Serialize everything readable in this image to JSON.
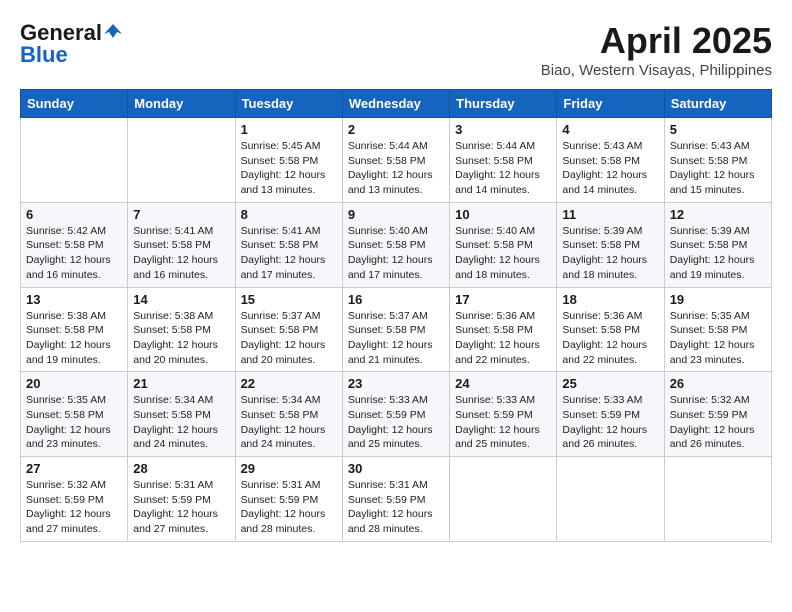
{
  "header": {
    "logo_general": "General",
    "logo_blue": "Blue",
    "month": "April 2025",
    "location": "Biao, Western Visayas, Philippines"
  },
  "weekdays": [
    "Sunday",
    "Monday",
    "Tuesday",
    "Wednesday",
    "Thursday",
    "Friday",
    "Saturday"
  ],
  "weeks": [
    [
      {
        "day": "",
        "info": ""
      },
      {
        "day": "",
        "info": ""
      },
      {
        "day": "1",
        "info": "Sunrise: 5:45 AM\nSunset: 5:58 PM\nDaylight: 12 hours\nand 13 minutes."
      },
      {
        "day": "2",
        "info": "Sunrise: 5:44 AM\nSunset: 5:58 PM\nDaylight: 12 hours\nand 13 minutes."
      },
      {
        "day": "3",
        "info": "Sunrise: 5:44 AM\nSunset: 5:58 PM\nDaylight: 12 hours\nand 14 minutes."
      },
      {
        "day": "4",
        "info": "Sunrise: 5:43 AM\nSunset: 5:58 PM\nDaylight: 12 hours\nand 14 minutes."
      },
      {
        "day": "5",
        "info": "Sunrise: 5:43 AM\nSunset: 5:58 PM\nDaylight: 12 hours\nand 15 minutes."
      }
    ],
    [
      {
        "day": "6",
        "info": "Sunrise: 5:42 AM\nSunset: 5:58 PM\nDaylight: 12 hours\nand 16 minutes."
      },
      {
        "day": "7",
        "info": "Sunrise: 5:41 AM\nSunset: 5:58 PM\nDaylight: 12 hours\nand 16 minutes."
      },
      {
        "day": "8",
        "info": "Sunrise: 5:41 AM\nSunset: 5:58 PM\nDaylight: 12 hours\nand 17 minutes."
      },
      {
        "day": "9",
        "info": "Sunrise: 5:40 AM\nSunset: 5:58 PM\nDaylight: 12 hours\nand 17 minutes."
      },
      {
        "day": "10",
        "info": "Sunrise: 5:40 AM\nSunset: 5:58 PM\nDaylight: 12 hours\nand 18 minutes."
      },
      {
        "day": "11",
        "info": "Sunrise: 5:39 AM\nSunset: 5:58 PM\nDaylight: 12 hours\nand 18 minutes."
      },
      {
        "day": "12",
        "info": "Sunrise: 5:39 AM\nSunset: 5:58 PM\nDaylight: 12 hours\nand 19 minutes."
      }
    ],
    [
      {
        "day": "13",
        "info": "Sunrise: 5:38 AM\nSunset: 5:58 PM\nDaylight: 12 hours\nand 19 minutes."
      },
      {
        "day": "14",
        "info": "Sunrise: 5:38 AM\nSunset: 5:58 PM\nDaylight: 12 hours\nand 20 minutes."
      },
      {
        "day": "15",
        "info": "Sunrise: 5:37 AM\nSunset: 5:58 PM\nDaylight: 12 hours\nand 20 minutes."
      },
      {
        "day": "16",
        "info": "Sunrise: 5:37 AM\nSunset: 5:58 PM\nDaylight: 12 hours\nand 21 minutes."
      },
      {
        "day": "17",
        "info": "Sunrise: 5:36 AM\nSunset: 5:58 PM\nDaylight: 12 hours\nand 22 minutes."
      },
      {
        "day": "18",
        "info": "Sunrise: 5:36 AM\nSunset: 5:58 PM\nDaylight: 12 hours\nand 22 minutes."
      },
      {
        "day": "19",
        "info": "Sunrise: 5:35 AM\nSunset: 5:58 PM\nDaylight: 12 hours\nand 23 minutes."
      }
    ],
    [
      {
        "day": "20",
        "info": "Sunrise: 5:35 AM\nSunset: 5:58 PM\nDaylight: 12 hours\nand 23 minutes."
      },
      {
        "day": "21",
        "info": "Sunrise: 5:34 AM\nSunset: 5:58 PM\nDaylight: 12 hours\nand 24 minutes."
      },
      {
        "day": "22",
        "info": "Sunrise: 5:34 AM\nSunset: 5:58 PM\nDaylight: 12 hours\nand 24 minutes."
      },
      {
        "day": "23",
        "info": "Sunrise: 5:33 AM\nSunset: 5:59 PM\nDaylight: 12 hours\nand 25 minutes."
      },
      {
        "day": "24",
        "info": "Sunrise: 5:33 AM\nSunset: 5:59 PM\nDaylight: 12 hours\nand 25 minutes."
      },
      {
        "day": "25",
        "info": "Sunrise: 5:33 AM\nSunset: 5:59 PM\nDaylight: 12 hours\nand 26 minutes."
      },
      {
        "day": "26",
        "info": "Sunrise: 5:32 AM\nSunset: 5:59 PM\nDaylight: 12 hours\nand 26 minutes."
      }
    ],
    [
      {
        "day": "27",
        "info": "Sunrise: 5:32 AM\nSunset: 5:59 PM\nDaylight: 12 hours\nand 27 minutes."
      },
      {
        "day": "28",
        "info": "Sunrise: 5:31 AM\nSunset: 5:59 PM\nDaylight: 12 hours\nand 27 minutes."
      },
      {
        "day": "29",
        "info": "Sunrise: 5:31 AM\nSunset: 5:59 PM\nDaylight: 12 hours\nand 28 minutes."
      },
      {
        "day": "30",
        "info": "Sunrise: 5:31 AM\nSunset: 5:59 PM\nDaylight: 12 hours\nand 28 minutes."
      },
      {
        "day": "",
        "info": ""
      },
      {
        "day": "",
        "info": ""
      },
      {
        "day": "",
        "info": ""
      }
    ]
  ]
}
